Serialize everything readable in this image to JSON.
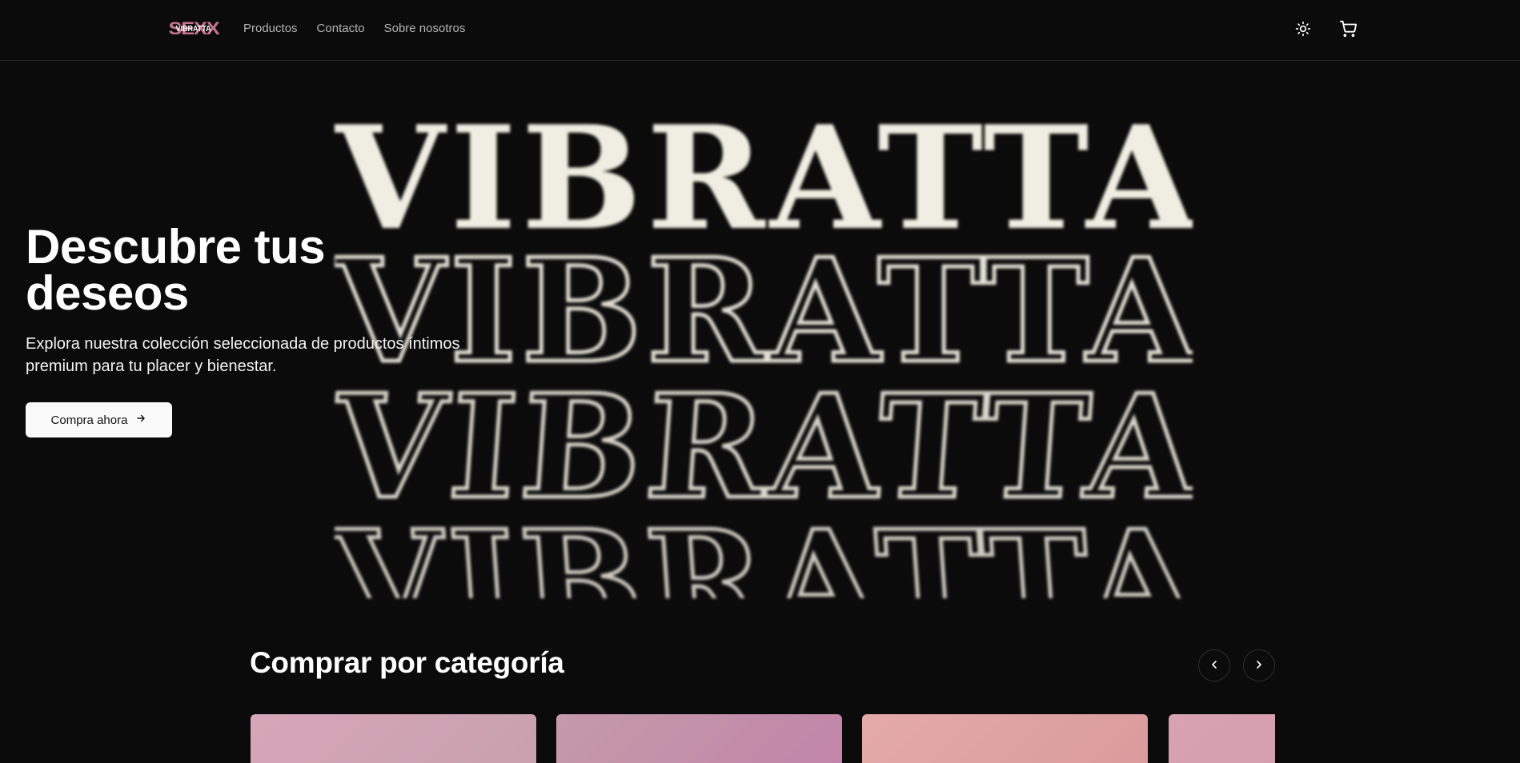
{
  "header": {
    "logo_text": "VIBRATTA",
    "logo_mark": "SEXX",
    "nav": [
      {
        "label": "Productos"
      },
      {
        "label": "Contacto"
      },
      {
        "label": "Sobre nosotros"
      }
    ],
    "theme_icon": "sun-icon",
    "cart_icon": "cart-icon"
  },
  "hero": {
    "art_text": "VIBRATTA",
    "title_line1": "Descubre tus",
    "title_line2": "deseos",
    "subtitle": "Explora nuestra colección seleccionada de productos íntimos premium para tu placer y bienestar.",
    "cta_label": "Compra ahora",
    "cta_icon": "arrow-right-icon"
  },
  "categories": {
    "title": "Comprar por categoría",
    "prev_icon": "chevron-left-icon",
    "next_icon": "chevron-right-icon",
    "cards": [
      {
        "gradient_from": "#d7a6b8",
        "gradient_to": "#c7a0ad"
      },
      {
        "gradient_from": "#c59aa9",
        "gradient_to": "#c184a9"
      },
      {
        "gradient_from": "#e4aaa8",
        "gradient_to": "#d99a9c"
      },
      {
        "gradient_from": "#d9a2b3",
        "gradient_to": "#cf9aaa"
      }
    ]
  },
  "colors": {
    "background": "#0b0b0b",
    "accent_pink": "#c9748f",
    "text": "#ffffff",
    "muted_text": "#b5b5b5"
  }
}
